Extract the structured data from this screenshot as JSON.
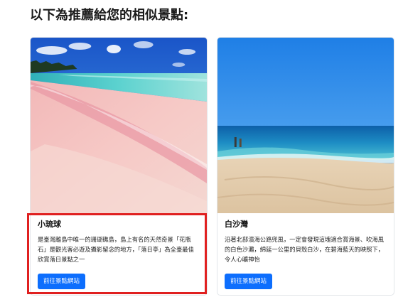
{
  "page": {
    "heading": "以下為推薦給您的相似景點:"
  },
  "cards": [
    {
      "title": "小琉球",
      "description": "是臺灣離島中唯一的珊瑚礁島，島上有名的天然奇景「花瓶石」是觀光客必遊及攝影留念的地方，「落日亭」為全臺最佳欣賞落日景點之一",
      "button_label": "前往景點網站",
      "image": "pink sand beach photo"
    },
    {
      "title": "白沙灣",
      "description": "沿著北部濱海公路兜風，一定會發現這塊適合賞海景、吹海風的白色沙灘，綿延一公里的貝殼白沙，在碧海藍天的映照下，令人心曠神怡",
      "button_label": "前往景點網站",
      "image": "white sand beach photo"
    }
  ],
  "colors": {
    "button": "#0d6efd",
    "highlight": "#e02020"
  }
}
